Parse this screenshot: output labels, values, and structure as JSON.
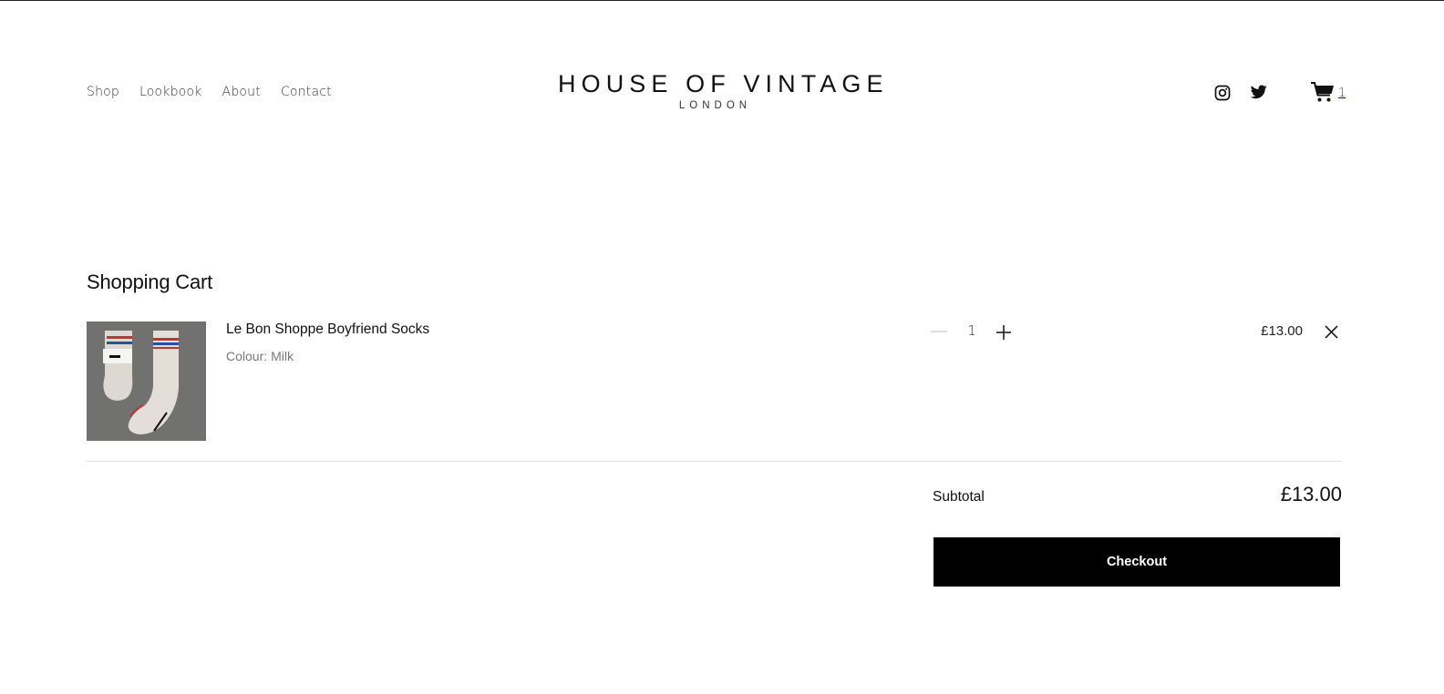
{
  "header": {
    "nav": [
      "Shop",
      "Lookbook",
      "About",
      "Contact"
    ],
    "logo": {
      "main": "HOUSE OF VINTAGE",
      "sub": "LONDON"
    },
    "social": [
      "instagram-icon",
      "twitter-icon"
    ],
    "cart_count": "1"
  },
  "cart": {
    "title": "Shopping Cart",
    "items": [
      {
        "name": "Le Bon Shoppe Boyfriend Socks",
        "variant_label": "Colour:",
        "variant_value": "Milk",
        "quantity": "1",
        "price": "£13.00"
      }
    ],
    "subtotal_label": "Subtotal",
    "subtotal_value": "£13.00",
    "checkout_label": "Checkout"
  },
  "colors": {
    "accent": "#000000",
    "background": "#ffffff"
  }
}
